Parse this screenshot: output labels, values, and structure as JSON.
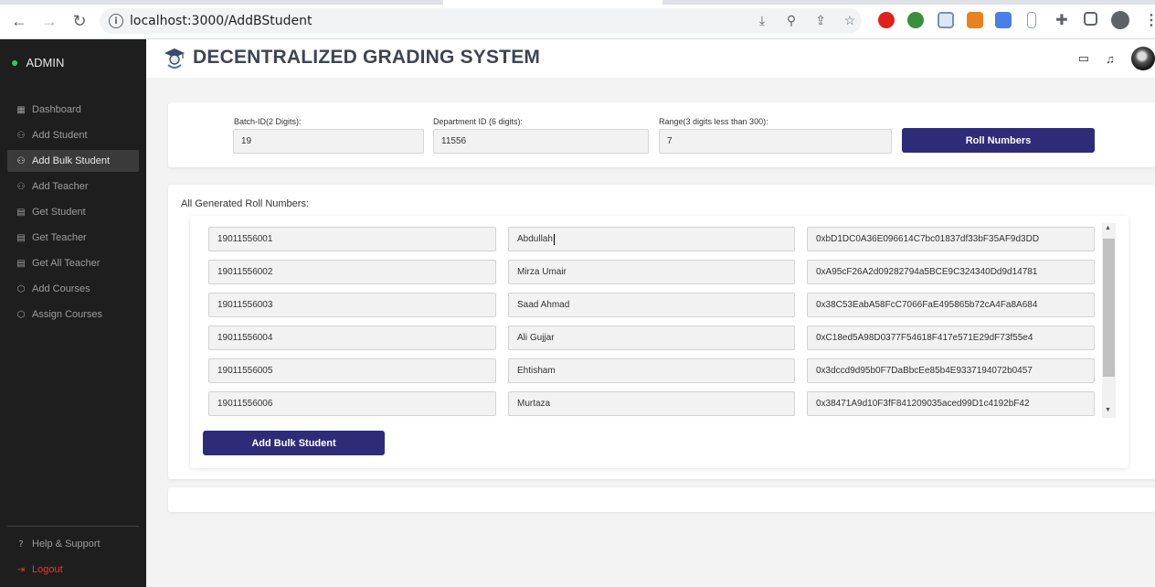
{
  "browser": {
    "url": "localhost:3000/AddBStudent"
  },
  "sidebar": {
    "admin_label": "ADMIN",
    "items": [
      {
        "label": "Dashboard",
        "icon": "grid-icon"
      },
      {
        "label": "Add Student",
        "icon": "users-icon"
      },
      {
        "label": "Add Bulk Student",
        "icon": "users-icon",
        "active": true
      },
      {
        "label": "Add Teacher",
        "icon": "users-icon"
      },
      {
        "label": "Get Student",
        "icon": "file-icon"
      },
      {
        "label": "Get Teacher",
        "icon": "file-icon"
      },
      {
        "label": "Get All Teacher",
        "icon": "file-icon"
      },
      {
        "label": "Add Courses",
        "icon": "box-icon"
      },
      {
        "label": "Assign Courses",
        "icon": "box-icon"
      }
    ],
    "help_label": "Help & Support",
    "logout_label": "Logout"
  },
  "header": {
    "title": "DECENTRALIZED GRADING SYSTEM"
  },
  "form": {
    "batch_label": "Batch-ID(2 Digits):",
    "batch_value": "19",
    "dept_label": "Department ID (6 digits):",
    "dept_value": "11556",
    "range_label": "Range(3 digits less than 300):",
    "range_value": "7",
    "roll_button": "Roll Numbers"
  },
  "roll_section": {
    "title": "All Generated Roll Numbers:",
    "rows": [
      {
        "roll": "19011556001",
        "name": "Abdullah",
        "address": "0xbD1DC0A36E096614C7bc01837df33bF35AF9d3DD"
      },
      {
        "roll": "19011556002",
        "name": "Mirza Umair",
        "address": "0xA95cF26A2d09282794a5BCE9C324340Dd9d14781"
      },
      {
        "roll": "19011556003",
        "name": "Saad Ahmad",
        "address": "0x38C53EabA58FcC7066FaE495865b72cA4Fa8A684"
      },
      {
        "roll": "19011556004",
        "name": "Ali Gujjar",
        "address": "0xC18ed5A98D0377F54618F417e571E29dF73f55e4"
      },
      {
        "roll": "19011556005",
        "name": "Ehtisham",
        "address": "0x3dccd9d95b0F7DaBbcEe85b4E9337194072b0457"
      },
      {
        "roll": "19011556006",
        "name": "Murtaza",
        "address": "0x38471A9d10F3fF841209035aced99D1c4192bF42"
      }
    ],
    "submit_button": "Add Bulk Student"
  }
}
